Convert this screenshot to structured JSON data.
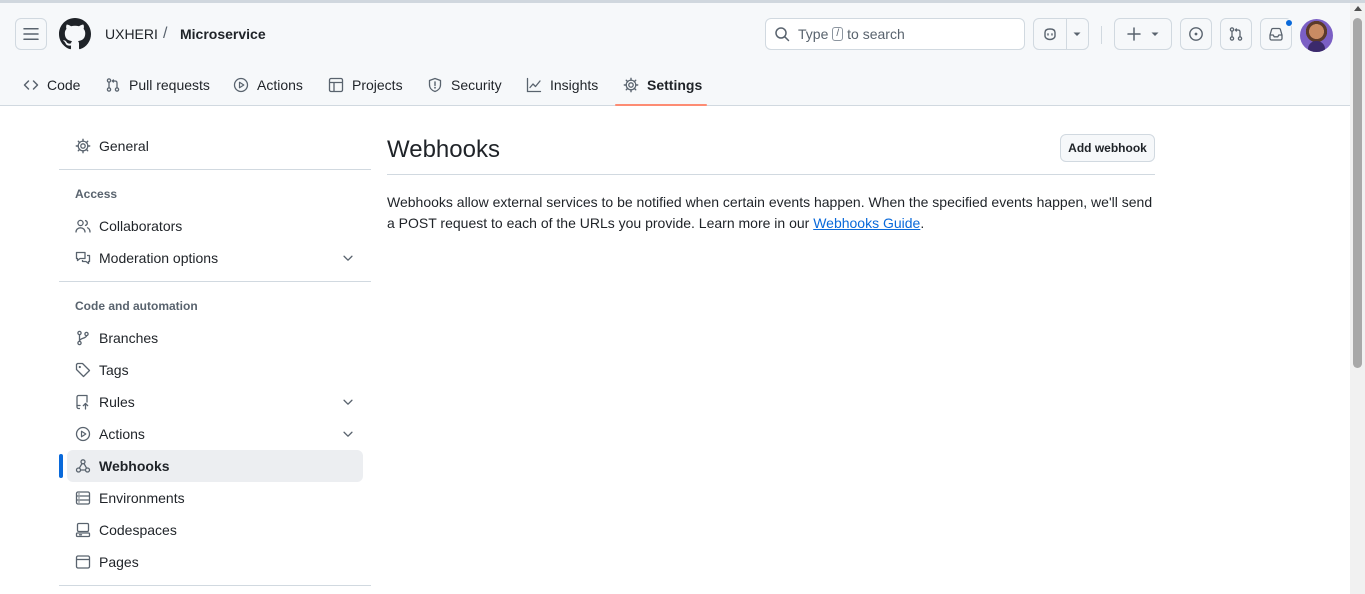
{
  "header": {
    "owner": "UXHERI",
    "separator": "/",
    "repo": "Microservice",
    "search": {
      "prefix": "Type",
      "key": "/",
      "suffix": "to search"
    }
  },
  "repo_nav": {
    "tabs": [
      {
        "label": "Code",
        "icon": "code-icon"
      },
      {
        "label": "Pull requests",
        "icon": "git-pull-request-icon"
      },
      {
        "label": "Actions",
        "icon": "play-icon"
      },
      {
        "label": "Projects",
        "icon": "table-icon"
      },
      {
        "label": "Security",
        "icon": "shield-icon"
      },
      {
        "label": "Insights",
        "icon": "graph-icon"
      },
      {
        "label": "Settings",
        "icon": "gear-icon",
        "selected": true
      }
    ]
  },
  "sidebar": {
    "general": "General",
    "access_heading": "Access",
    "access_items": [
      {
        "label": "Collaborators",
        "icon": "people-icon"
      },
      {
        "label": "Moderation options",
        "icon": "comment-discussion-icon",
        "expandable": true
      }
    ],
    "code_heading": "Code and automation",
    "code_items": [
      {
        "label": "Branches",
        "icon": "git-branch-icon"
      },
      {
        "label": "Tags",
        "icon": "tag-icon"
      },
      {
        "label": "Rules",
        "icon": "repo-push-icon",
        "expandable": true
      },
      {
        "label": "Actions",
        "icon": "play-icon",
        "expandable": true
      },
      {
        "label": "Webhooks",
        "icon": "webhook-icon",
        "active": true
      },
      {
        "label": "Environments",
        "icon": "server-icon"
      },
      {
        "label": "Codespaces",
        "icon": "codespaces-icon"
      },
      {
        "label": "Pages",
        "icon": "browser-icon"
      }
    ]
  },
  "main": {
    "title": "Webhooks",
    "add_button": "Add webhook",
    "description": "Webhooks allow external services to be notified when certain events happen. When the specified events happen, we'll send a POST request to each of the URLs you provide. Learn more in our",
    "link_text": "Webhooks Guide",
    "trailing": "."
  },
  "colors": {
    "accent": "#0969da",
    "tab_underline": "#fd8c73",
    "text": "#1f2328",
    "muted": "#59636e"
  }
}
